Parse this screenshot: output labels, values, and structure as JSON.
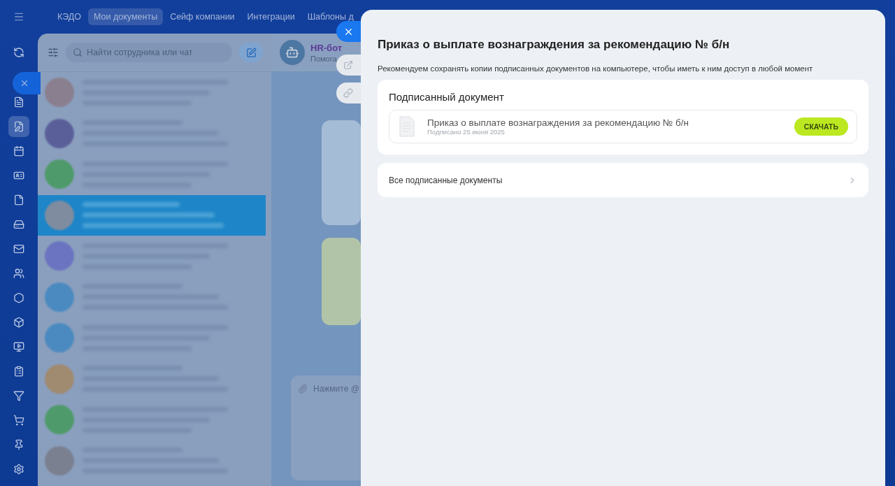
{
  "nav": {
    "tabs": [
      {
        "label": "КЭДО",
        "selected": false
      },
      {
        "label": "Мои документы",
        "selected": true
      },
      {
        "label": "Сейф компании",
        "selected": false
      },
      {
        "label": "Интеграции",
        "selected": false
      },
      {
        "label": "Шаблоны д",
        "selected": false
      }
    ]
  },
  "sidebar": {
    "items": [
      {
        "selected": false
      },
      {
        "selected": false
      },
      {
        "selected": true
      },
      {
        "selected": false
      },
      {
        "selected": false
      },
      {
        "selected": false
      },
      {
        "selected": false
      },
      {
        "selected": false
      },
      {
        "selected": false
      },
      {
        "selected": false
      },
      {
        "selected": false
      },
      {
        "selected": false
      },
      {
        "selected": false
      },
      {
        "selected": false
      },
      {
        "selected": false
      },
      {
        "selected": false
      },
      {
        "selected": false
      }
    ]
  },
  "chat_list": {
    "search": {
      "placeholder": "Найти сотрудника или чат"
    },
    "chats": [
      {
        "selected": false,
        "color": "#8a7f8e"
      },
      {
        "selected": false,
        "color": "#5a5f9a"
      },
      {
        "selected": false,
        "color": "#4f9a6a"
      },
      {
        "selected": true,
        "color": "#7f8ca0"
      },
      {
        "selected": false,
        "color": "#6a74c0"
      },
      {
        "selected": false,
        "color": "#4a8ac0"
      },
      {
        "selected": false,
        "color": "#4a8ac0"
      },
      {
        "selected": false,
        "color": "#a08a70"
      },
      {
        "selected": false,
        "color": "#4f9a6a"
      },
      {
        "selected": false,
        "color": "#7a8090"
      }
    ]
  },
  "chat": {
    "title": "HR-бот",
    "subtitle": "Помога",
    "input": {
      "placeholder": "Нажмите @"
    }
  },
  "panel": {
    "title": "Приказ о выплате вознаграждения за рекомендацию № б/н",
    "hint": "Рекомендуем сохранять копии подписанных документов на компьютере, чтобы иметь к ним доступ в любой момент",
    "signed": {
      "heading": "Подписанный документ",
      "document": {
        "name": "Приказ о выплате вознаграждения за рекомендацию № б/н",
        "date": "Подписано 25 июня 2025"
      },
      "button": "СКАЧАТЬ"
    },
    "all_link": "Все подписанные документы"
  }
}
